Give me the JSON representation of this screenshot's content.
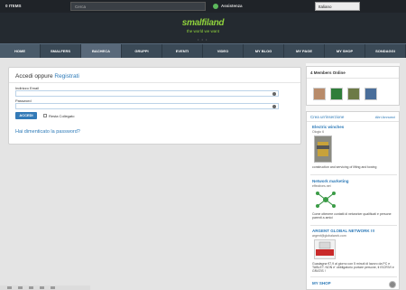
{
  "topbar": {
    "items_label": "0 ITEMS",
    "search_placeholder": "Cerca",
    "assist_label": "Assistenza",
    "language": "Italiano"
  },
  "header": {
    "logo": "smalfiland",
    "tagline": "the world we want",
    "dots": "• • •"
  },
  "nav": [
    "HOME",
    "SMALFERS",
    "BACHECA",
    "GRUPPI",
    "EVENTI",
    "VIDEO",
    "MY BLOG",
    "MY PAGE",
    "MY SHOP",
    "SONDAGGI"
  ],
  "login": {
    "title_prefix": "Accedi oppure ",
    "register_link": "Registrati",
    "email_label": "Indirizzo Email",
    "password_label": "Password",
    "submit_label": "ACCEDI",
    "remember_label": "Resta Collegato",
    "forgot_link": "Hai dimenticato la password?"
  },
  "members": {
    "title": "4 Members Online",
    "avatar_colors": [
      "#b88b6a",
      "#2f7d3a",
      "#6c7a46",
      "#4a6e9a"
    ]
  },
  "ads": {
    "create_label": "Crea un'inserzione",
    "all_label": "Altri Annunci",
    "items": [
      {
        "title": "Electric winches",
        "subtitle": "Ologio 6",
        "desc": "construction and servicing of lifting and towing"
      },
      {
        "title": "Network marketing",
        "subtitle": "effectives.net",
        "desc": "Come ottenere contatti di networker qualificati e persone parenti a amici"
      },
      {
        "title": "ARGENT GLOBAL NETWORK !!!",
        "subtitle": "argent@globalwork.com",
        "desc": "Guadagna €7,9 al giorno con 5 minuti di lavoro da PC e TABLET. NON e' obbligatorio portare persone, ti ISCRIVI e GRATIS !"
      },
      {
        "title": "MY SHOP",
        "subtitle": "",
        "desc": ""
      }
    ]
  }
}
